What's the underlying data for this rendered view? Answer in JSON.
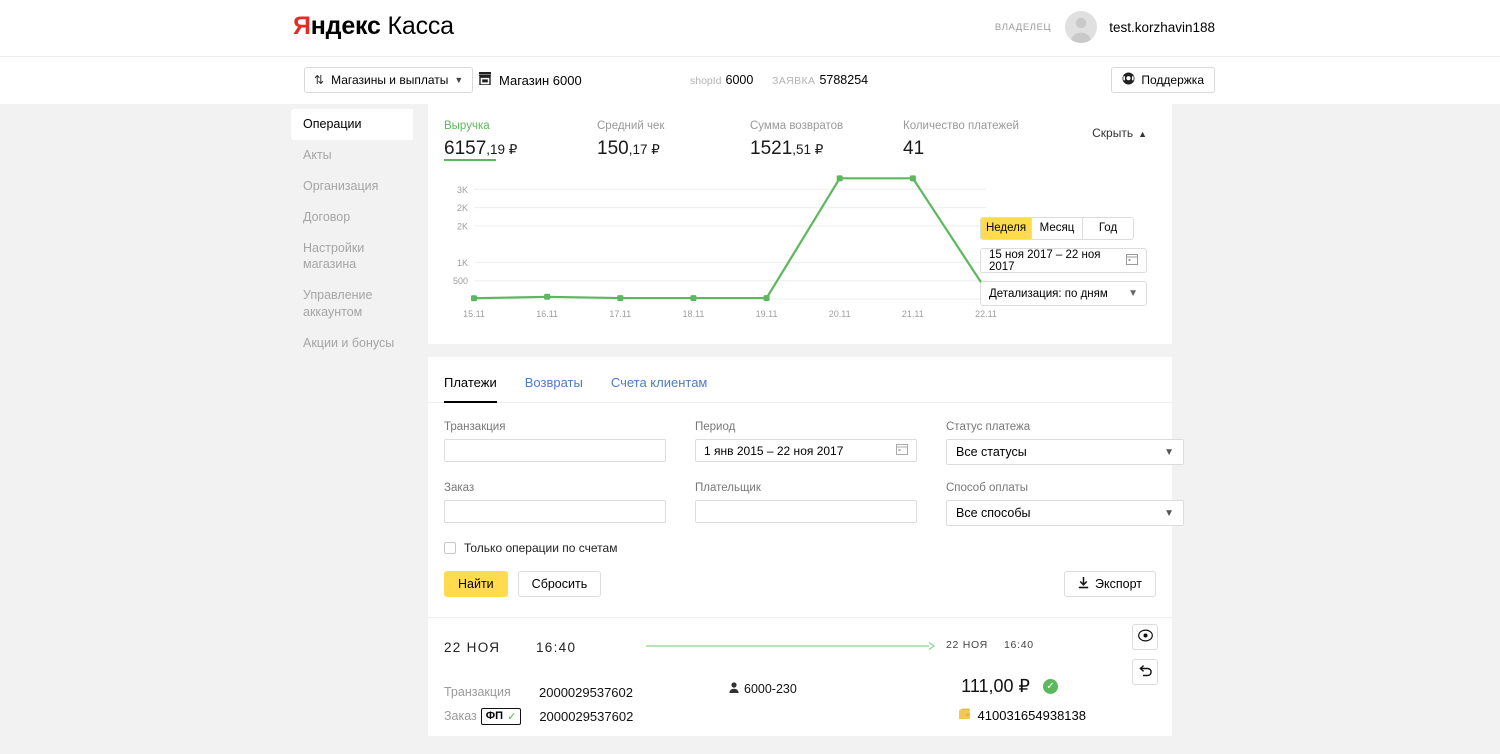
{
  "header": {
    "logo_ya": "Я",
    "logo_ndeks": "ндекс",
    "logo_kassa": "Касса",
    "owner_label": "ВЛАДЕЛЕЦ",
    "username": "test.korzhavin188",
    "avatar_icon": "user-avatar-icon"
  },
  "toolbar": {
    "shops_button": "Магазины и выплаты",
    "shops_icon": "sort-arrows-icon",
    "shops_chevron": "chevron-down-icon",
    "shop_icon": "store-icon",
    "shop_name": "Магазин 6000",
    "shopid_key": "shopId",
    "shopid_value": "6000",
    "zayavka_key": "ЗАЯВКА",
    "zayavka_value": "5788254",
    "support_label": "Поддержка",
    "support_icon": "headset-icon"
  },
  "sidebar": {
    "items": [
      {
        "label": "Операции",
        "active": true
      },
      {
        "label": "Акты",
        "active": false
      },
      {
        "label": "Организация",
        "active": false
      },
      {
        "label": "Договор",
        "active": false
      },
      {
        "label": "Настройки магазина",
        "active": false
      },
      {
        "label": "Управление аккаунтом",
        "active": false
      },
      {
        "label": "Акции и бонусы",
        "active": false
      }
    ]
  },
  "stats": {
    "items": [
      {
        "label": "Выручка",
        "value": "6157",
        "decimals": ",19 ₽",
        "active": true
      },
      {
        "label": "Средний чек",
        "value": "150",
        "decimals": ",17 ₽",
        "active": false
      },
      {
        "label": "Сумма возвратов",
        "value": "1521",
        "decimals": ",51 ₽",
        "active": false
      },
      {
        "label": "Количество платежей",
        "value": "41",
        "decimals": "",
        "active": false
      }
    ],
    "hide_label": "Скрыть",
    "hide_chevron": "chevron-up-icon"
  },
  "chart_controls": {
    "segments": [
      {
        "label": "Неделя",
        "active": true
      },
      {
        "label": "Месяц",
        "active": false
      },
      {
        "label": "Год",
        "active": false
      }
    ],
    "date_range": "15 ноя 2017 – 22 ноя 2017",
    "calendar_icon": "calendar-icon",
    "detail_select": "Детализация: по дням",
    "detail_chevron": "chevron-down-icon"
  },
  "chart_data": {
    "type": "line",
    "title": "",
    "xlabel": "",
    "ylabel": "",
    "categories": [
      "15.11",
      "16.11",
      "17.11",
      "18.11",
      "19.11",
      "20.11",
      "21.11",
      "22.11"
    ],
    "series": [
      {
        "name": "Выручка",
        "color": "#5cb85c",
        "values": [
          20,
          60,
          25,
          25,
          25,
          3300,
          3300,
          250
        ]
      }
    ],
    "ytick_labels": [
      "3K",
      "2K",
      "2K",
      "1K",
      "500"
    ],
    "ytick_values": [
      3000,
      2500,
      2000,
      1000,
      500
    ],
    "ylim": [
      0,
      3500
    ],
    "grid": true,
    "legend": "none"
  },
  "tabs": [
    {
      "label": "Платежи",
      "active": true
    },
    {
      "label": "Возвраты",
      "active": false
    },
    {
      "label": "Счета клиентам",
      "active": false
    }
  ],
  "filters": {
    "transaction_label": "Транзакция",
    "transaction_value": "",
    "period_label": "Период",
    "period_value": "1 янв 2015 – 22 ноя 2017",
    "period_icon": "calendar-icon",
    "status_label": "Статус платежа",
    "status_value": "Все статусы",
    "order_label": "Заказ",
    "order_value": "",
    "payer_label": "Плательщик",
    "payer_value": "",
    "method_label": "Способ оплаты",
    "method_value": "Все способы",
    "checkbox_label": "Только операции по счетам",
    "checkbox_checked": false,
    "find_button": "Найти",
    "reset_button": "Сбросить",
    "export_button": "Экспорт",
    "export_icon": "download-icon"
  },
  "transaction": {
    "start_date": "22 НОЯ",
    "start_time": "16:40",
    "end_date": "22 НОЯ",
    "end_time": "16:40",
    "transaction_label": "Транзакция",
    "transaction_id": "2000029537602",
    "order_label": "Заказ",
    "order_badge": "ФП",
    "order_badge_tick": "✓",
    "order_id": "2000029537602",
    "payer_icon": "person-icon",
    "payer_value": "6000-230",
    "amount": "111,00 ₽",
    "status_icon": "check-circle-icon",
    "wallet_icon": "wallet-icon",
    "wallet_number": "410031654938138",
    "view_icon": "eye-icon",
    "refund_icon": "undo-icon"
  },
  "colors": {
    "accent_yellow": "#ffdb4d",
    "green": "#5cb85c",
    "link_blue": "#4d7cc7",
    "brand_red": "#e52d27"
  }
}
